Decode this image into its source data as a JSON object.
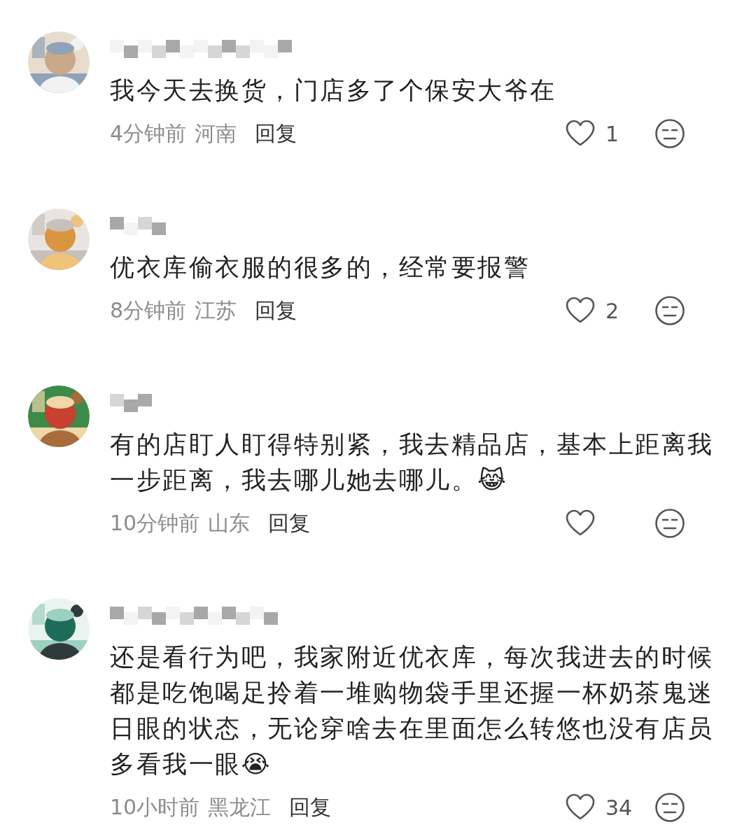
{
  "comments": [
    {
      "text": "我今天去换货，门店多了个保安大爷在",
      "time": "4分钟前",
      "location": "河南",
      "reply": "回复",
      "likes": "1"
    },
    {
      "text": "优衣库偷衣服的很多的，经常要报警",
      "time": "8分钟前",
      "location": "江苏",
      "reply": "回复",
      "likes": "2"
    },
    {
      "text": "有的店盯人盯得特别紧，我去精品店，基本上距离我一步距离，我去哪儿她去哪儿。😹",
      "time": "10分钟前",
      "location": "山东",
      "reply": "回复"
    },
    {
      "text": "还是看行为吧，我家附近优衣库，每次我进去的时候都是吃饱喝足拎着一堆购物袋手里还握一杯奶茶鬼迷日眼的状态，无论穿啥去在里面怎么转悠也没有店员多看我一眼😭",
      "time": "10小时前",
      "location": "黑龙江",
      "reply": "回复",
      "likes": "34"
    }
  ]
}
